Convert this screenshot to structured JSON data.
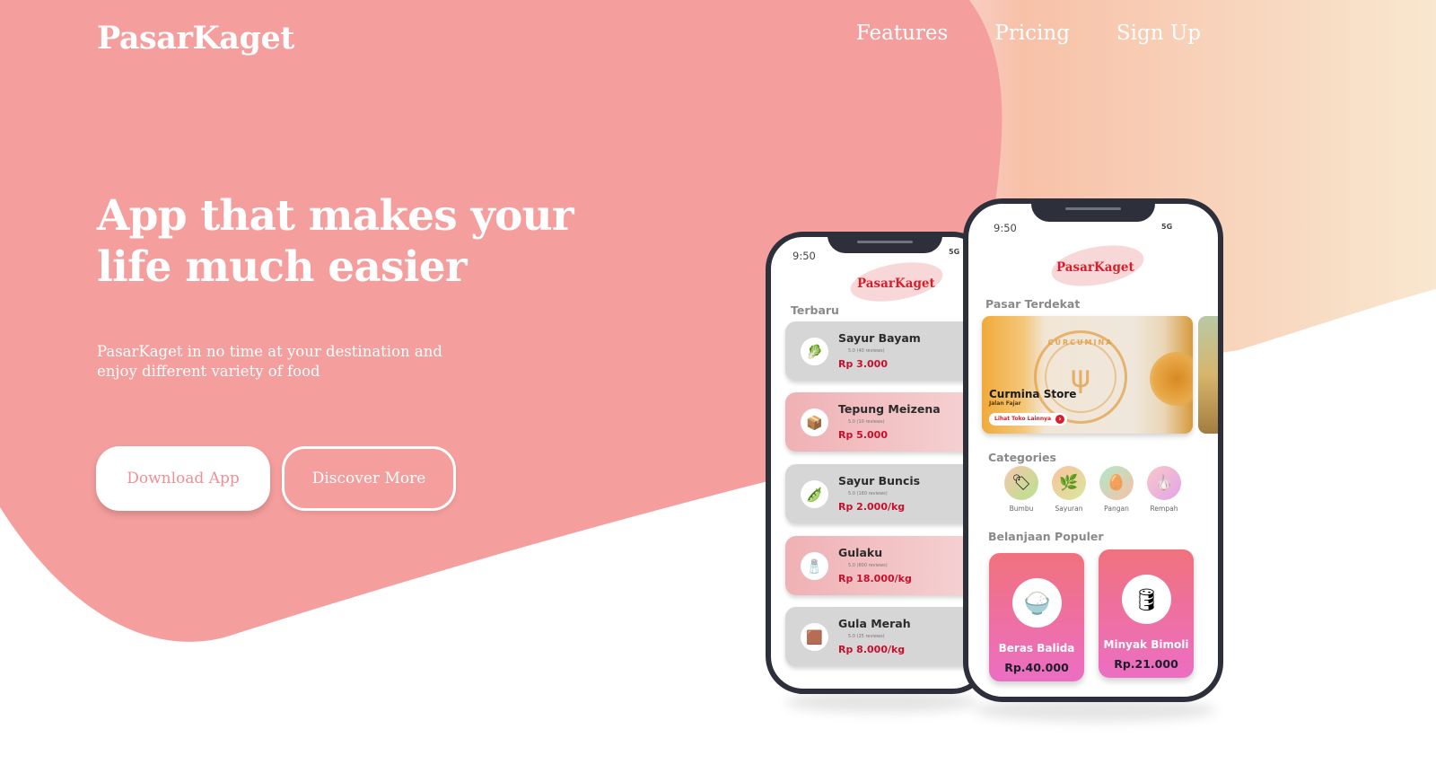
{
  "brand": "PasarKaget",
  "nav": {
    "features": "Features",
    "pricing": "Pricing",
    "sign_up": "Sign Up"
  },
  "hero": {
    "title_line1": "App that makes your",
    "title_line2": "life much easier",
    "subtitle_line1": "PasarKaget in no time at your destination and",
    "subtitle_line2": "enjoy different variety of food",
    "download_label": "Download App",
    "discover_label": "Discover More"
  },
  "colors": {
    "hero_pink": "#f59e9e",
    "peach": "#f9e7cf",
    "accent_red": "#d61f2c",
    "price_red": "#c8102e"
  },
  "phone_left": {
    "time": "9:50",
    "signal": "5G",
    "app_logo": "PasarKaget",
    "section_title": "Terbaru",
    "items": [
      {
        "name": "Sayur Bayam",
        "rating": "5.0 (40 reviews)",
        "price": "Rp 3.000",
        "icon": "spinach-icon",
        "glyph": "🥬"
      },
      {
        "name": "Tepung Meizena",
        "rating": "5.0 (10 reviews)",
        "price": "Rp 5.000",
        "icon": "flour-pack-icon",
        "glyph": "📦"
      },
      {
        "name": "Sayur Buncis",
        "rating": "5.0 (160 reviews)",
        "price": "Rp 2.000/kg",
        "icon": "green-beans-icon",
        "glyph": "🫛"
      },
      {
        "name": "Gulaku",
        "rating": "5.0 (800 reviews)",
        "price": "Rp 18.000/kg",
        "icon": "sugar-pack-icon",
        "glyph": "🧂"
      },
      {
        "name": "Gula Merah",
        "rating": "5.0 (25 reviews)",
        "price": "Rp 8.000/kg",
        "icon": "palm-sugar-icon",
        "glyph": "🟫"
      }
    ]
  },
  "phone_right": {
    "time": "9:50",
    "signal": "5G",
    "app_logo": "PasarKaget",
    "nearest_title": "Pasar Terdekat",
    "store": {
      "name": "Curmina Store",
      "address": "Jalan Fajar",
      "link": "Lihat Toko Lainnya",
      "emblem_text": "CURCUMINA"
    },
    "categories_title": "Categories",
    "categories": [
      {
        "label": "Bumbu",
        "icon": "spice-tag-icon",
        "glyph": "🏷"
      },
      {
        "label": "Sayuran",
        "icon": "leaf-icon",
        "glyph": "🌿"
      },
      {
        "label": "Pangan",
        "icon": "egg-icon",
        "glyph": "🥚"
      },
      {
        "label": "Rempah",
        "icon": "garlic-icon",
        "glyph": "🧄"
      }
    ],
    "popular_title": "Belanjaan Populer",
    "popular": [
      {
        "name": "Beras Balida",
        "price": "Rp.40.000",
        "icon": "rice-bag-icon",
        "glyph": "🍚"
      },
      {
        "name": "Minyak Bimoli",
        "price": "Rp.21.000",
        "icon": "cooking-oil-icon",
        "glyph": "🛢"
      }
    ]
  }
}
